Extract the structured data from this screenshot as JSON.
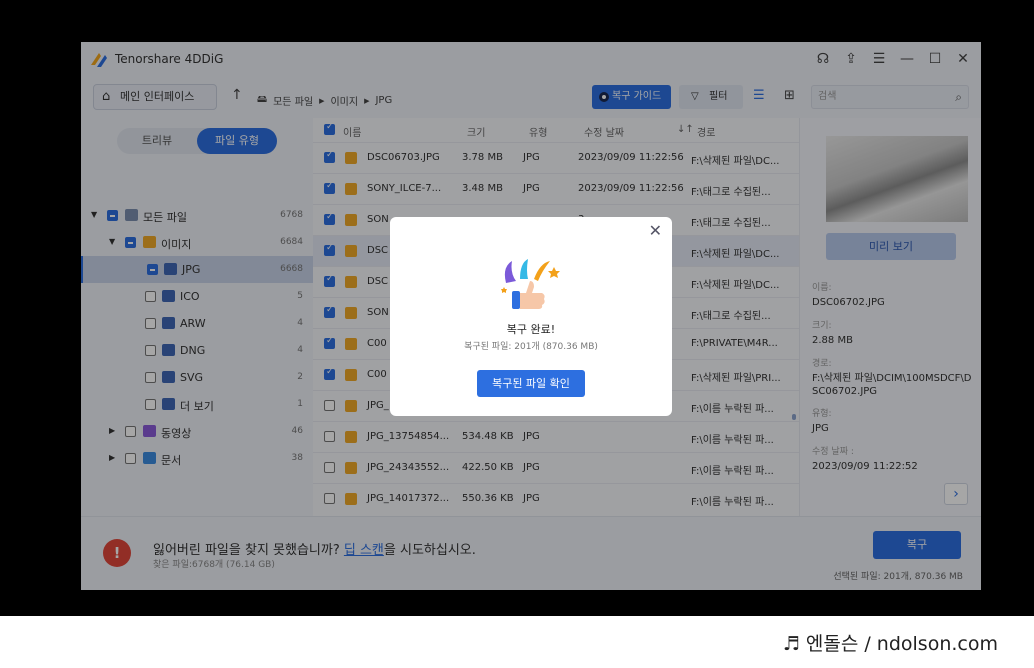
{
  "app": {
    "title": "Tenorshare 4DDiG"
  },
  "toolbar": {
    "home_label": "메인 인터페이스",
    "breadcrumb": [
      "모든 파일",
      "이미지",
      "JPG"
    ],
    "guide_label": "복구 가이드",
    "filter_label": "필터",
    "search_placeholder": "검색"
  },
  "sidebar": {
    "tabs": [
      "트리뷰",
      "파일 유형"
    ],
    "items": [
      {
        "label": "모든 파일",
        "count": "6768"
      },
      {
        "label": "이미지",
        "count": "6684"
      },
      {
        "label": "JPG",
        "count": "6668"
      },
      {
        "label": "ICO",
        "count": "5"
      },
      {
        "label": "ARW",
        "count": "4"
      },
      {
        "label": "DNG",
        "count": "4"
      },
      {
        "label": "SVG",
        "count": "2"
      },
      {
        "label": "더 보기",
        "count": "1"
      },
      {
        "label": "동영상",
        "count": "46"
      },
      {
        "label": "문서",
        "count": "38"
      }
    ]
  },
  "list": {
    "columns": [
      "이름",
      "크기",
      "유형",
      "수정 날짜",
      "경로"
    ],
    "rows": [
      {
        "name": "DSC06703.JPG",
        "size": "3.78 MB",
        "type": "JPG",
        "date": "2023/09/09 11:22:56",
        "path": "F:\\삭제된 파일\\DC...",
        "checked": true
      },
      {
        "name": "SONY_ILCE-7...",
        "size": "3.48 MB",
        "type": "JPG",
        "date": "2023/09/09 11:22:56",
        "path": "F:\\태그로 수집된...",
        "checked": true
      },
      {
        "name": "SON",
        "size": "",
        "type": "",
        "date": "3",
        "path": "F:\\태그로 수집된...",
        "checked": true
      },
      {
        "name": "DSC",
        "size": "",
        "type": "",
        "date": "2",
        "path": "F:\\삭제된 파일\\DC...",
        "checked": true
      },
      {
        "name": "DSC",
        "size": "",
        "type": "",
        "date": "2",
        "path": "F:\\삭제된 파일\\DC...",
        "checked": true
      },
      {
        "name": "SON",
        "size": "",
        "type": "",
        "date": "1",
        "path": "F:\\태그로 수집된...",
        "checked": true
      },
      {
        "name": "C00",
        "size": "",
        "type": "",
        "date": "0",
        "path": "F:\\PRIVATE\\M4R...",
        "checked": true
      },
      {
        "name": "C00",
        "size": "",
        "type": "",
        "date": "0",
        "path": "F:\\삭제된 파일\\PRI...",
        "checked": true
      },
      {
        "name": "JPG_",
        "size": "",
        "type": "",
        "date": "",
        "path": "F:\\이름 누락된 파...",
        "checked": false
      },
      {
        "name": "JPG_13754854...",
        "size": "534.48 KB",
        "type": "JPG",
        "date": "",
        "path": "F:\\이름 누락된 파...",
        "checked": false
      },
      {
        "name": "JPG_24343552...",
        "size": "422.50 KB",
        "type": "JPG",
        "date": "",
        "path": "F:\\이름 누락된 파...",
        "checked": false
      },
      {
        "name": "JPG_14017372...",
        "size": "550.36 KB",
        "type": "JPG",
        "date": "",
        "path": "F:\\이름 누락된 파...",
        "checked": false
      }
    ]
  },
  "preview": {
    "button": "미리 보기",
    "name_key": "이름:",
    "name_val": "DSC06702.JPG",
    "size_key": "크기:",
    "size_val": "2.88 MB",
    "path_key": "경로:",
    "path_val": "F:\\삭제된 파일\\DCIM\\100MSDCF\\DSC06702.JPG",
    "type_key": "유형:",
    "type_val": "JPG",
    "date_key": "수정 날짜 :",
    "date_val": "2023/09/09 11:22:52"
  },
  "bottom": {
    "msg_pre": "잃어버린 파일을 찾지 못했습니까? ",
    "msg_link": "딥 스캔",
    "msg_post": "을 시도하십시오.",
    "found": "찾은 파일:6768개 (76.14 GB)",
    "recover": "복구",
    "selected": "선택된 파일: 201개, 870.36 MB"
  },
  "modal": {
    "title": "복구 완료!",
    "subtitle": "복구된 파일: 201개 (870.36 MB)",
    "button": "복구된 파일 확인"
  },
  "watermark": "♬ 엔돌슨 / ndolson.com",
  "colors": {
    "accent": "#2d6fe0",
    "warn": "#e0473b"
  }
}
